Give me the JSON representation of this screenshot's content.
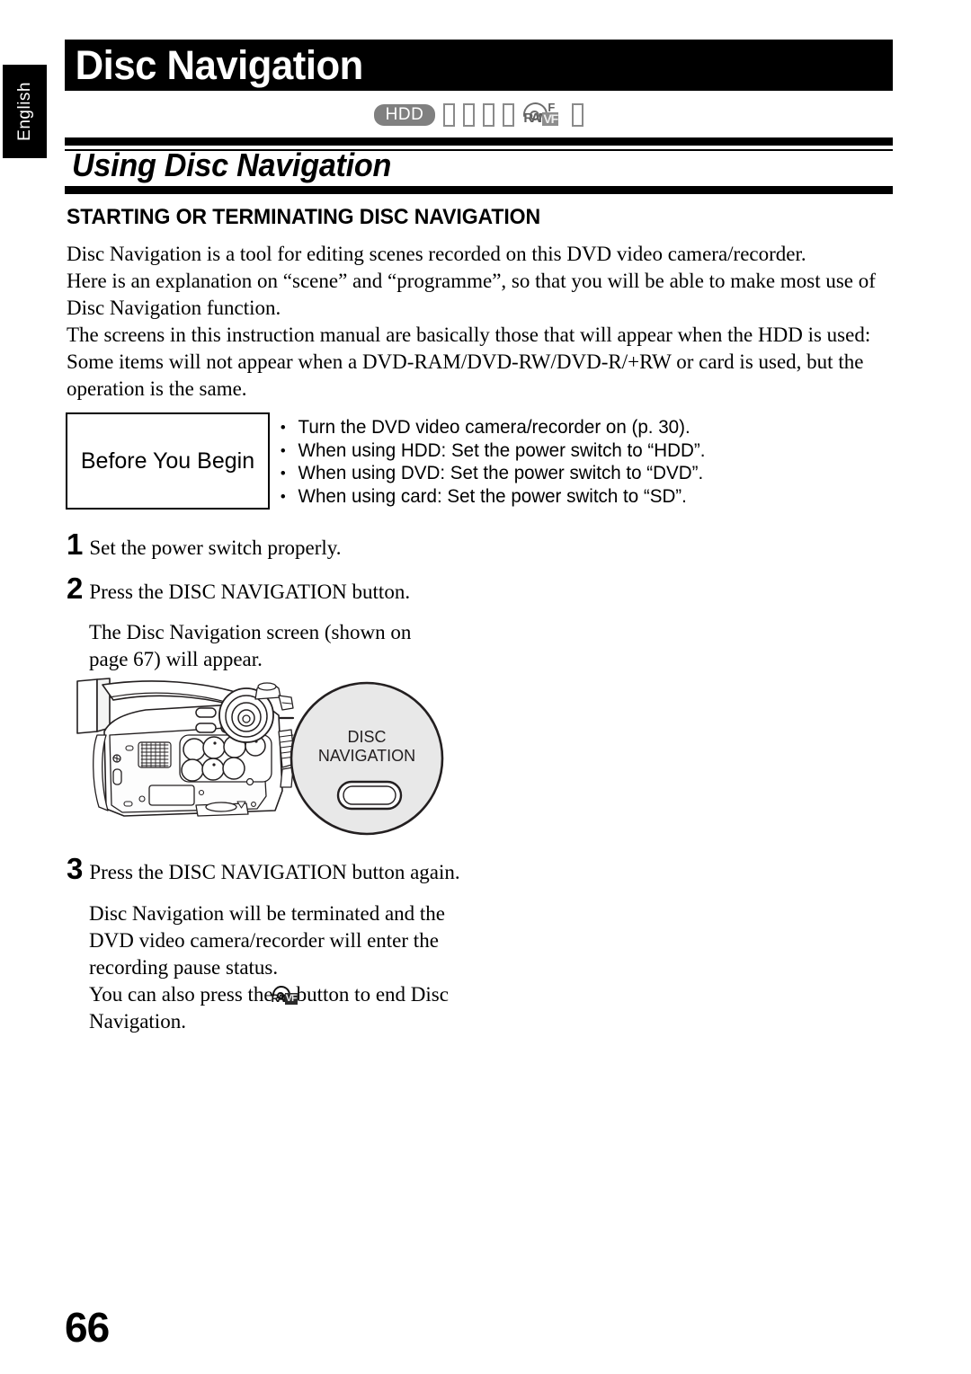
{
  "page": {
    "language_tab": "English",
    "chapter_title": "Disc Navigation",
    "section_title": "Using Disc Navigation",
    "sub_heading": "STARTING OR TERMINATING DISC NAVIGATION",
    "page_number": "66"
  },
  "media_icons": {
    "hdd_badge": "HDD",
    "cluster": {
      "letters": "RAM",
      "superscript": "F",
      "boxed": "VF"
    },
    "tofu_count": 4,
    "trailing_tofu_count": 1
  },
  "intro": {
    "lines": [
      "Disc Navigation is a tool for editing scenes recorded on this DVD video camera/recorder.",
      "Here is an explanation on “scene” and “programme”, so that you will be able to make most use of",
      "Disc Navigation function.",
      "The screens in this instruction manual are basically those that will appear when the HDD is used:",
      "Some items will not appear when a DVD-RAM/DVD-RW/DVD-R/+RW or card is used, but the",
      "operation is the same."
    ]
  },
  "before_you_begin": {
    "label": "Before You Begin",
    "items": [
      "Turn the DVD video camera/recorder on (p. 30).",
      "When using HDD: Set the power switch to “HDD”.",
      "When using DVD: Set the power switch to “DVD”.",
      "When using card: Set the power switch to “SD”."
    ]
  },
  "steps": [
    {
      "number": "1",
      "text": "Set the power switch properly."
    },
    {
      "number": "2",
      "text": "Press the DISC NAVIGATION button.",
      "body": [
        "The Disc Navigation screen (shown on",
        "page 67) will appear."
      ]
    },
    {
      "number": "3",
      "text": "Press the DISC NAVIGATION button again.",
      "body": [
        "Disc Navigation will be terminated and the",
        "DVD video camera/recorder will enter the",
        "recording pause status."
      ],
      "body_with_glyph": {
        "before": "You can also press the",
        "after": "button to end Disc",
        "tail": "Navigation."
      }
    }
  ],
  "illustration": {
    "callout_label_line1": "DISC",
    "callout_label_line2": "NAVIGATION"
  },
  "colors": {
    "header_bar": "#000000",
    "hdd_badge": "#808080",
    "callout_fill": "#e8e8e8",
    "line_art": "#231f20"
  }
}
